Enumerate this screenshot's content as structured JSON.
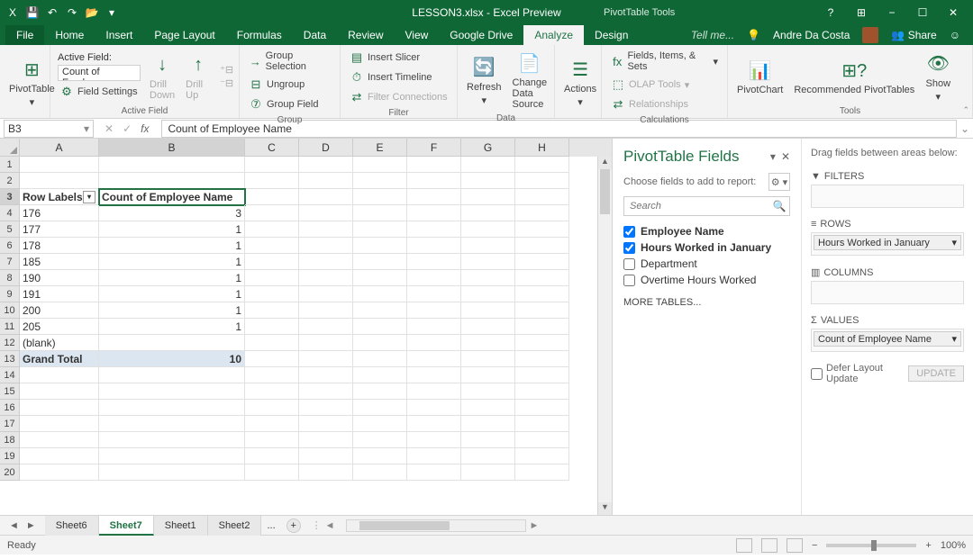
{
  "title": "LESSON3.xlsx - Excel Preview",
  "context_tab": "PivotTable Tools",
  "win_btns": {
    "help": "?",
    "ribbon": "▢",
    "min": "−",
    "max": "☐",
    "close": "✕"
  },
  "qat": [
    "save-icon",
    "undo-icon",
    "redo-icon",
    "open-icon",
    "customize-icon"
  ],
  "tabs": [
    "File",
    "Home",
    "Insert",
    "Page Layout",
    "Formulas",
    "Data",
    "Review",
    "View",
    "Google Drive",
    "Analyze",
    "Design"
  ],
  "tell_me": "Tell me...",
  "user": "Andre Da Costa",
  "share": "Share",
  "ribbon": {
    "pivot": {
      "label": "PivotTable"
    },
    "active_field": {
      "title": "Active Field:",
      "value": "Count of Employe",
      "settings": "Field Settings",
      "drill_down": "Drill Down",
      "drill_up": "Drill Up",
      "group_label": "Active Field"
    },
    "group": {
      "sel": "Group Selection",
      "un": "Ungroup",
      "fld": "Group Field",
      "label": "Group"
    },
    "filter": {
      "slicer": "Insert Slicer",
      "timeline": "Insert Timeline",
      "conn": "Filter Connections",
      "label": "Filter"
    },
    "data": {
      "refresh": "Refresh",
      "change": "Change Data Source",
      "label": "Data"
    },
    "actions": {
      "btn": "Actions"
    },
    "calc": {
      "fis": "Fields, Items, & Sets",
      "olap": "OLAP Tools",
      "rel": "Relationships",
      "label": "Calculations"
    },
    "tools": {
      "pc": "PivotChart",
      "rec": "Recommended PivotTables",
      "show": "Show",
      "label": "Tools"
    }
  },
  "namebox": "B3",
  "formula": "Count of Employee Name",
  "columns": [
    "A",
    "B",
    "C",
    "D",
    "E",
    "F",
    "G",
    "H"
  ],
  "pivot_rows": [
    {
      "r": 3,
      "a": "Row Labels",
      "b": "Count of Employee Name",
      "hdr": true
    },
    {
      "r": 4,
      "a": "176",
      "b": "3"
    },
    {
      "r": 5,
      "a": "177",
      "b": "1"
    },
    {
      "r": 6,
      "a": "178",
      "b": "1"
    },
    {
      "r": 7,
      "a": "185",
      "b": "1"
    },
    {
      "r": 8,
      "a": "190",
      "b": "1"
    },
    {
      "r": 9,
      "a": "191",
      "b": "1"
    },
    {
      "r": 10,
      "a": "200",
      "b": "1"
    },
    {
      "r": 11,
      "a": "205",
      "b": "1"
    },
    {
      "r": 12,
      "a": "(blank)",
      "b": ""
    },
    {
      "r": 13,
      "a": "Grand Total",
      "b": "10",
      "gt": true
    }
  ],
  "empty_rows": [
    1,
    2,
    14,
    15,
    16,
    17,
    18,
    19,
    20
  ],
  "pt": {
    "title": "PivotTable Fields",
    "sub": "Choose fields to add to report:",
    "search": "Search",
    "fields": [
      {
        "label": "Employee Name",
        "checked": true
      },
      {
        "label": "Hours Worked in January",
        "checked": true
      },
      {
        "label": "Department",
        "checked": false
      },
      {
        "label": "Overtime Hours Worked",
        "checked": false
      }
    ],
    "more": "MORE TABLES...",
    "drag": "Drag fields between areas below:",
    "areas": {
      "filters": "FILTERS",
      "rows": "ROWS",
      "rows_item": "Hours Worked in January",
      "columns": "COLUMNS",
      "values": "VALUES",
      "values_item": "Count of Employee Name"
    },
    "defer": "Defer Layout Update",
    "update": "UPDATE"
  },
  "sheets": [
    "Sheet6",
    "Sheet7",
    "Sheet1",
    "Sheet2"
  ],
  "sheets_more": "...",
  "status": "Ready",
  "zoom": "100%"
}
